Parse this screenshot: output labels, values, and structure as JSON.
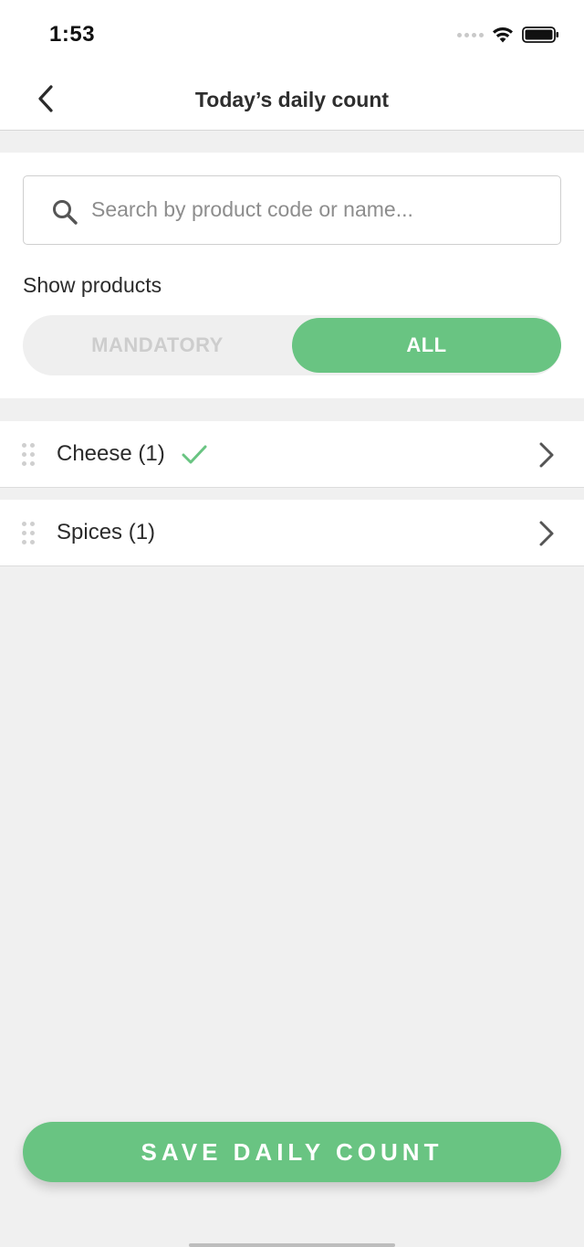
{
  "status_bar": {
    "time": "1:53",
    "icons": [
      "signal-dots-icon",
      "wifi-icon",
      "battery-icon"
    ]
  },
  "nav": {
    "title": "Today’s daily count",
    "back_icon": "chevron-left-icon"
  },
  "search": {
    "placeholder": "Search by product code or name...",
    "value": "",
    "icon": "search-icon"
  },
  "filter": {
    "label": "Show products",
    "options": [
      "MANDATORY",
      "ALL"
    ],
    "selected": "ALL"
  },
  "categories": [
    {
      "label": "Cheese (1)",
      "completed": true
    },
    {
      "label": "Spices (1)",
      "completed": false
    }
  ],
  "save_button": {
    "label": "SAVE DAILY COUNT"
  },
  "colors": {
    "accent": "#69c482",
    "background": "#f0f0f0",
    "surface": "#ffffff",
    "inactive_text": "#cdcdcd"
  }
}
